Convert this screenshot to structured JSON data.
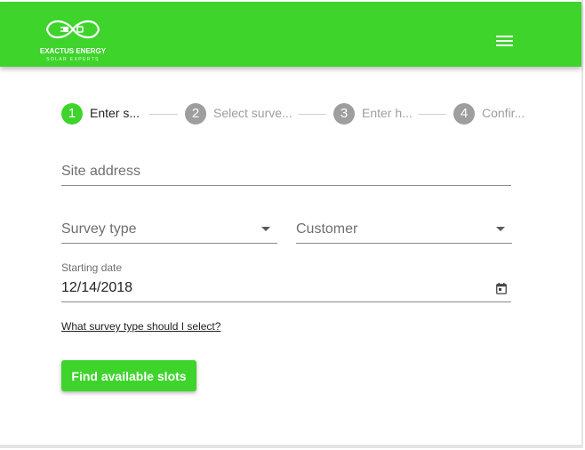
{
  "brand": {
    "name": "EXACTUS ENERGY",
    "tagline": "SOLAR EXPERTS",
    "color": "#3ed42c"
  },
  "header": {
    "menu_icon": "hamburger-menu-icon"
  },
  "stepper": {
    "steps": [
      {
        "number": "1",
        "label": "Enter s...",
        "state": "active"
      },
      {
        "number": "2",
        "label": "Select surve...",
        "state": "inactive"
      },
      {
        "number": "3",
        "label": "Enter h...",
        "state": "inactive"
      },
      {
        "number": "4",
        "label": "Confir...",
        "state": "inactive"
      }
    ]
  },
  "form": {
    "site_address": {
      "placeholder": "Site address",
      "value": ""
    },
    "survey_type": {
      "placeholder": "Survey type"
    },
    "customer": {
      "placeholder": "Customer"
    },
    "starting_date": {
      "label": "Starting date",
      "value": "12/14/2018",
      "icon": "calendar-icon"
    },
    "help_link": "What survey type should I select?",
    "submit_label": "Find available slots"
  }
}
